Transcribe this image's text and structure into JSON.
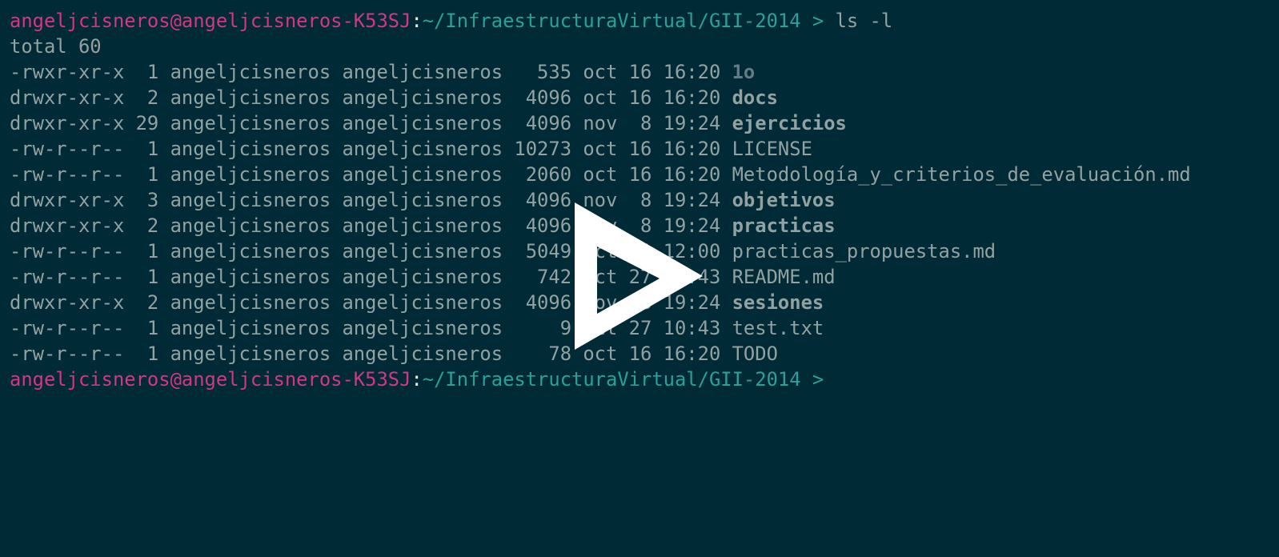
{
  "prompt": {
    "user_host": "angeljcisneros@angeljcisneros-K53SJ",
    "separator": ":",
    "path": "~/InfraestructuraVirtual/GII-2014",
    "symbol": " > "
  },
  "command": "ls -l",
  "total_line": "total 60",
  "listing": [
    {
      "meta": "-rwxr-xr-x  1 angeljcisneros angeljcisneros   535 oct 16 16:20 ",
      "name": "1o",
      "kind": "exec"
    },
    {
      "meta": "drwxr-xr-x  2 angeljcisneros angeljcisneros  4096 oct 16 16:20 ",
      "name": "docs",
      "kind": "dir"
    },
    {
      "meta": "drwxr-xr-x 29 angeljcisneros angeljcisneros  4096 nov  8 19:24 ",
      "name": "ejercicios",
      "kind": "dir"
    },
    {
      "meta": "-rw-r--r--  1 angeljcisneros angeljcisneros 10273 oct 16 16:20 ",
      "name": "LICENSE",
      "kind": "file"
    },
    {
      "meta": "-rw-r--r--  1 angeljcisneros angeljcisneros  2060 oct 16 16:20 ",
      "name": "Metodología_y_criterios_de_evaluación.md",
      "kind": "file"
    },
    {
      "meta": "drwxr-xr-x  3 angeljcisneros angeljcisneros  4096 nov  8 19:24 ",
      "name": "objetivos",
      "kind": "dir"
    },
    {
      "meta": "drwxr-xr-x  2 angeljcisneros angeljcisneros  4096 nov  8 19:24 ",
      "name": "practicas",
      "kind": "dir"
    },
    {
      "meta": "-rw-r--r--  1 angeljcisneros angeljcisneros  5049 oct  1 12:00 ",
      "name": "practicas_propuestas.md",
      "kind": "file"
    },
    {
      "meta": "-rw-r--r--  1 angeljcisneros angeljcisneros   742 oct 27 10:43 ",
      "name": "README.md",
      "kind": "file"
    },
    {
      "meta": "drwxr-xr-x  2 angeljcisneros angeljcisneros  4096 nov  8 19:24 ",
      "name": "sesiones",
      "kind": "dir"
    },
    {
      "meta": "-rw-r--r--  1 angeljcisneros angeljcisneros     9 oct 27 10:43 ",
      "name": "test.txt",
      "kind": "file"
    },
    {
      "meta": "-rw-r--r--  1 angeljcisneros angeljcisneros    78 oct 16 16:20 ",
      "name": "TODO",
      "kind": "file"
    }
  ],
  "play_icon": "play-icon",
  "colors": {
    "background": "#002b36",
    "user_host": "#d33682",
    "path": "#2aa198",
    "text": "#93a1a1",
    "play": "#ffffff"
  }
}
